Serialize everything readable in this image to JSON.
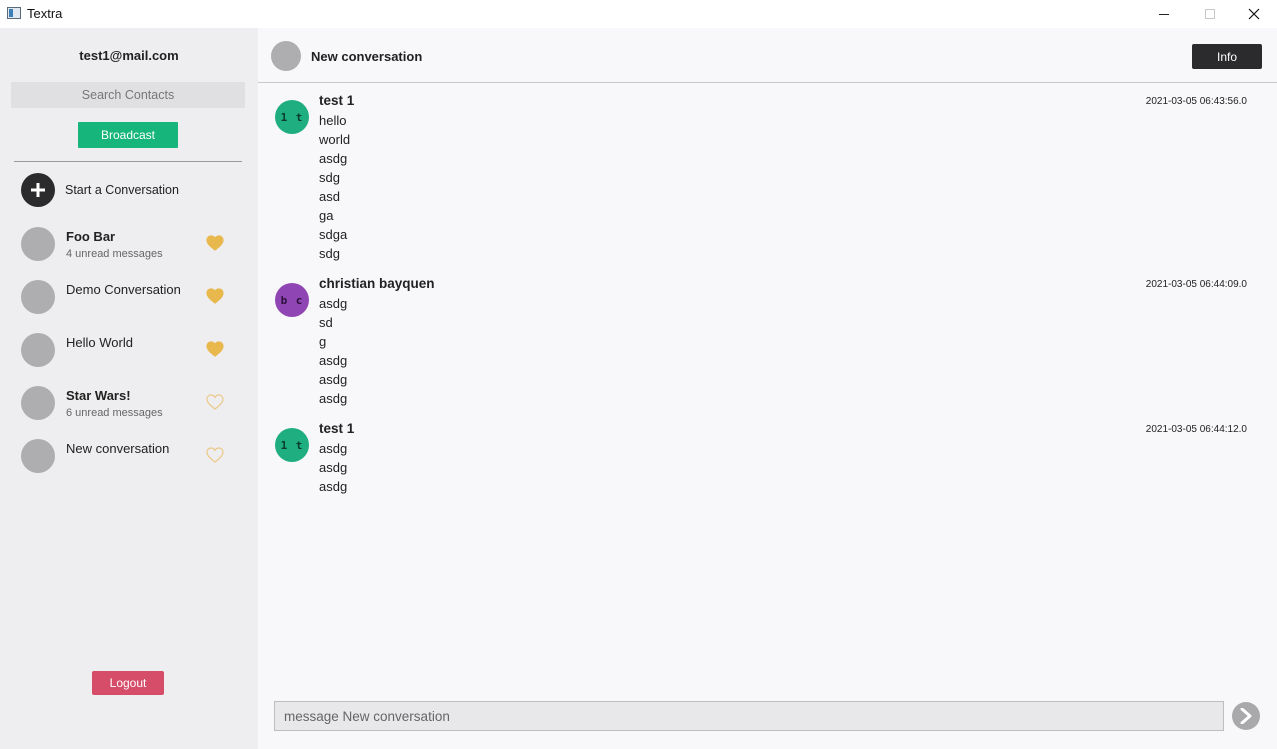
{
  "window": {
    "title": "Textra",
    "min_icon": "minimize-icon",
    "max_icon": "maximize-icon",
    "close_icon": "close-icon"
  },
  "sidebar": {
    "account_email": "test1@mail.com",
    "search_placeholder": "Search Contacts",
    "broadcast_label": "Broadcast",
    "start_label": "Start a Conversation",
    "conversations": [
      {
        "name": "Foo Bar",
        "unread": "4 unread messages",
        "bold": true,
        "favorite": true
      },
      {
        "name": "Demo Conversation",
        "unread": "",
        "bold": false,
        "favorite": true
      },
      {
        "name": "Hello World",
        "unread": "",
        "bold": false,
        "favorite": true
      },
      {
        "name": "Star Wars!",
        "unread": "6 unread messages",
        "bold": true,
        "favorite": false
      },
      {
        "name": "New conversation",
        "unread": "",
        "bold": false,
        "favorite": false
      }
    ],
    "logout_label": "Logout"
  },
  "header": {
    "title": "New conversation",
    "info_label": "Info"
  },
  "messages": [
    {
      "initials": "1 t",
      "author": "test 1",
      "time": "2021-03-05 06:43:56.0",
      "color": "#1fae7f",
      "lines": [
        "hello",
        "world",
        "asdg",
        "sdg",
        "asd",
        "ga",
        "sdga",
        "sdg"
      ]
    },
    {
      "initials": "b c",
      "author": "christian bayquen",
      "time": "2021-03-05 06:44:09.0",
      "color": "#8f45b3",
      "lines": [
        "asdg",
        "sd",
        "g",
        "asdg",
        "asdg",
        "asdg"
      ]
    },
    {
      "initials": "1 t",
      "author": "test 1",
      "time": "2021-03-05 06:44:12.0",
      "color": "#1fae7f",
      "lines": [
        "asdg",
        "asdg",
        "asdg"
      ]
    }
  ],
  "composer": {
    "placeholder": "message New conversation",
    "send_icon": "send-arrow-icon"
  },
  "colors": {
    "accent_green": "#15b57c",
    "logout_red": "#d64d6a",
    "heart": "#e8b84d",
    "dark": "#2b2b2d"
  }
}
